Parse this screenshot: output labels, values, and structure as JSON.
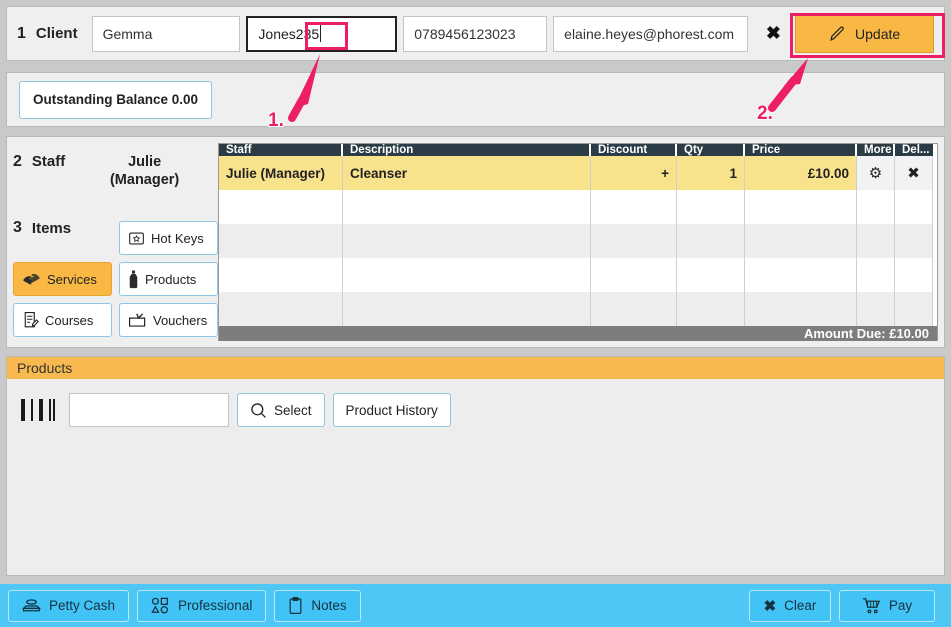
{
  "client": {
    "step_number": "1",
    "step_label": "Client",
    "first_name": "Gemma",
    "surname_prefix": "Jones",
    "surname_highlight": "235",
    "phone": "0789456123023",
    "email": "elaine.heyes@phorest.com",
    "close_icon": "close-x-icon",
    "update_label": "Update",
    "update_icon": "pencil-icon"
  },
  "balance": {
    "label": "Outstanding Balance 0.00"
  },
  "staff": {
    "step_number": "2",
    "step_label": "Staff",
    "name": "Julie\n(Manager)",
    "name_line1": "Julie",
    "name_line2": "(Manager)"
  },
  "items": {
    "step_number": "3",
    "step_label": "Items",
    "buttons": [
      {
        "label": "Hot Keys",
        "icon": "star-card-icon",
        "active": false
      },
      {
        "label": "Services",
        "icon": "hands-icon",
        "active": true
      },
      {
        "label": "Products",
        "icon": "bottle-icon",
        "active": false
      },
      {
        "label": "Courses",
        "icon": "notepad-icon",
        "active": false
      },
      {
        "label": "Vouchers",
        "icon": "gift-voucher-icon",
        "active": false
      }
    ]
  },
  "table": {
    "headers": [
      "Staff",
      "Description",
      "Discount",
      "Qty",
      "Price",
      "More",
      "Del..."
    ],
    "rows": [
      {
        "staff": "Julie (Manager)",
        "description": "Cleanser",
        "discount": "+",
        "qty": "1",
        "price": "£10.00",
        "more_icon": "gear-icon",
        "del_icon": "close-x-icon",
        "selected": true
      }
    ],
    "empty_row_count": 4,
    "amount_due": "Amount Due: £10.00"
  },
  "products": {
    "title": "Products",
    "barcode_icon": "barcode-icon",
    "search_value": "",
    "select_label": "Select",
    "select_icon": "magnifier-icon",
    "history_label": "Product History"
  },
  "bottom_bar": {
    "left_buttons": [
      {
        "label": "Petty Cash",
        "icon": "cash-drawer-icon"
      },
      {
        "label": "Professional",
        "icon": "shapes-icon"
      },
      {
        "label": "Notes",
        "icon": "clipboard-icon"
      }
    ],
    "right_buttons": [
      {
        "label": "Clear",
        "icon": "close-x-icon"
      },
      {
        "label": "Pay",
        "icon": "shopping-cart-icon"
      }
    ]
  },
  "annotations": [
    {
      "label": "1.",
      "target": "surname-field-highlight"
    },
    {
      "label": "2.",
      "target": "update-button"
    }
  ],
  "colors": {
    "accent_orange": "#f9b843",
    "annotation_pink": "#ec1e66",
    "header_dark": "#2b3c46",
    "row_yellow": "#f9e28c",
    "bottom_blue": "#4ec7f5"
  }
}
